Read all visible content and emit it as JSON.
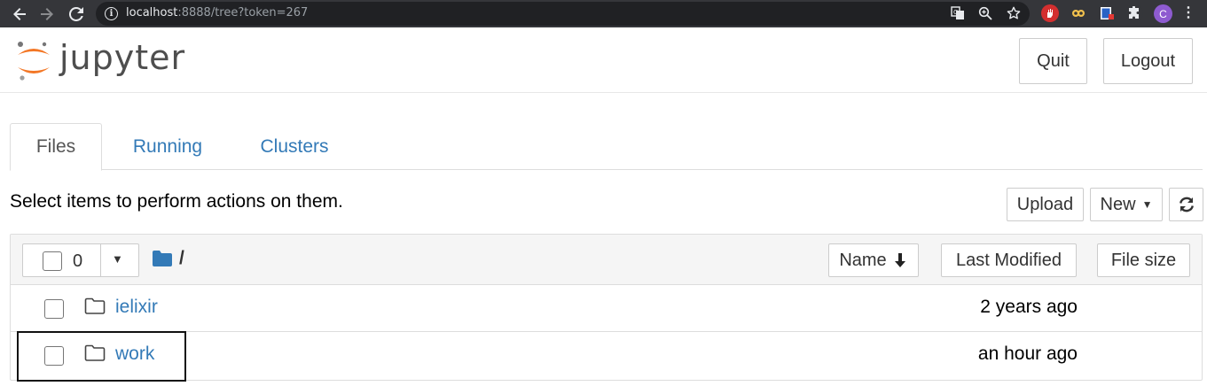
{
  "browser": {
    "url_host": "localhost",
    "url_rest": ":8888/tree?token=267",
    "profile_initial": "C"
  },
  "header": {
    "logo_text": "jupyter",
    "quit_label": "Quit",
    "logout_label": "Logout"
  },
  "tabs": [
    {
      "label": "Files",
      "active": true
    },
    {
      "label": "Running",
      "active": false
    },
    {
      "label": "Clusters",
      "active": false
    }
  ],
  "toolbar": {
    "hint": "Select items to perform actions on them.",
    "upload_label": "Upload",
    "new_label": "New"
  },
  "list": {
    "selected_count": "0",
    "path": "/",
    "columns": {
      "name": "Name",
      "last_modified": "Last Modified",
      "file_size": "File size"
    },
    "rows": [
      {
        "name": "ielixir",
        "modified": "2 years ago",
        "type": "folder"
      },
      {
        "name": "work",
        "modified": "an hour ago",
        "type": "folder"
      }
    ]
  },
  "colors": {
    "link": "#337ab7",
    "browser_bar": "#35363a",
    "jupyter_orange": "#f37726"
  }
}
